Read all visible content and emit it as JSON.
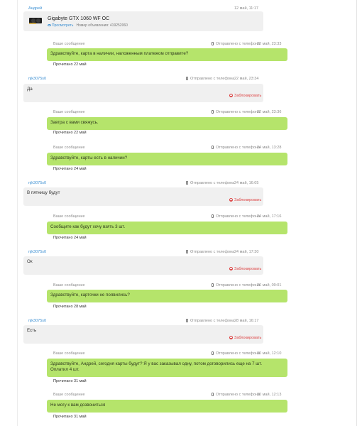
{
  "listing": {
    "sender": "Андрей",
    "date": "12 май, 11:17",
    "product_title": "Gigabyte GTX 1060 WF OC",
    "view_label": "Просмотреть",
    "ad_number_label": "Номер объявления:",
    "ad_number": "419252060"
  },
  "labels": {
    "your_message": "Ваше сообщение",
    "sent_from_phone": "Отправлено с телефона",
    "block": "Заблокировать"
  },
  "messages": [
    {
      "date": "22 май, 23:33",
      "text": "Здравствуйте, карта в наличии, наложенным платежом отправите?",
      "read": "Прочитано 22 май"
    },
    {
      "sender": "njk3075s0",
      "date": "22 май, 23:34",
      "text": "Да"
    },
    {
      "date": "22 май, 23:36",
      "text": "Завтра с вами свяжусь.",
      "read": "Прочитано 22 май"
    },
    {
      "date": "24 май, 13:28",
      "text": "Здравствуйте, карты есть в наличии?",
      "read": "Прочитано 24 май"
    },
    {
      "sender": "njk3075s0",
      "date": "24 май, 16:05",
      "text": "В пятницу будут"
    },
    {
      "date": "24 май, 17:16",
      "text": "Сообщите как будут хочу взять 3 шт.",
      "read": "Прочитано 24 май"
    },
    {
      "sender": "njk3075s0",
      "date": "24 май, 17:30",
      "text": "Ок"
    },
    {
      "date": "26 май, 09:01",
      "text": "Здравствуйте, карточки не появились?",
      "read": "Прочитано 28 май"
    },
    {
      "sender": "njk3075s0",
      "date": "28 май, 16:17",
      "text": "Есть"
    },
    {
      "date": "30 май, 12:10",
      "text": "Здравствуйте, Андрей, сегодня карты будут? Я у вас заказывал одну, потом договорились еще на 7 шт. Оплатил 4 шт.",
      "read": "Прочитано 31 май"
    },
    {
      "date": "30 май, 12:13",
      "text": "Не могу к вам дозвониться",
      "read": "Прочитано 31 май"
    }
  ]
}
